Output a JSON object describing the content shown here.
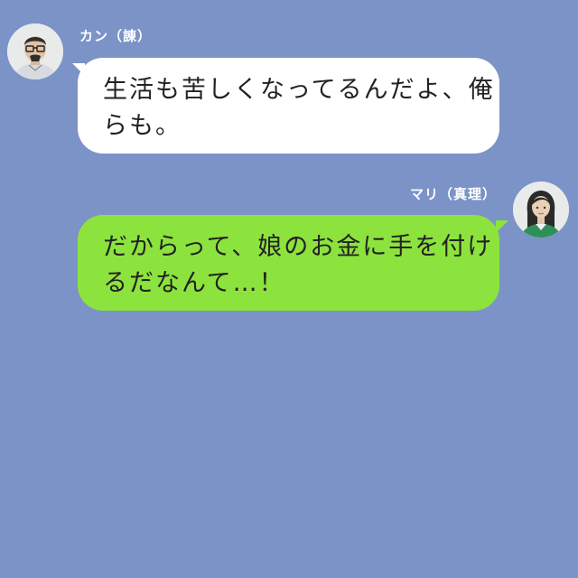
{
  "colors": {
    "background": "#7b93c6",
    "left_bubble": "#ffffff",
    "right_bubble": "#8de33d",
    "name_text": "#ffffff",
    "message_text": "#222222"
  },
  "messages": [
    {
      "side": "left",
      "sender": "カン（諌）",
      "avatar": "man-glasses-avatar",
      "lines": [
        "生活も苦しくなってるんだよ、俺",
        "らも。"
      ]
    },
    {
      "side": "right",
      "sender": "マリ（真理）",
      "avatar": "woman-avatar",
      "lines": [
        "だからって、娘のお金に手を付け",
        "るだなんて…！"
      ]
    }
  ]
}
